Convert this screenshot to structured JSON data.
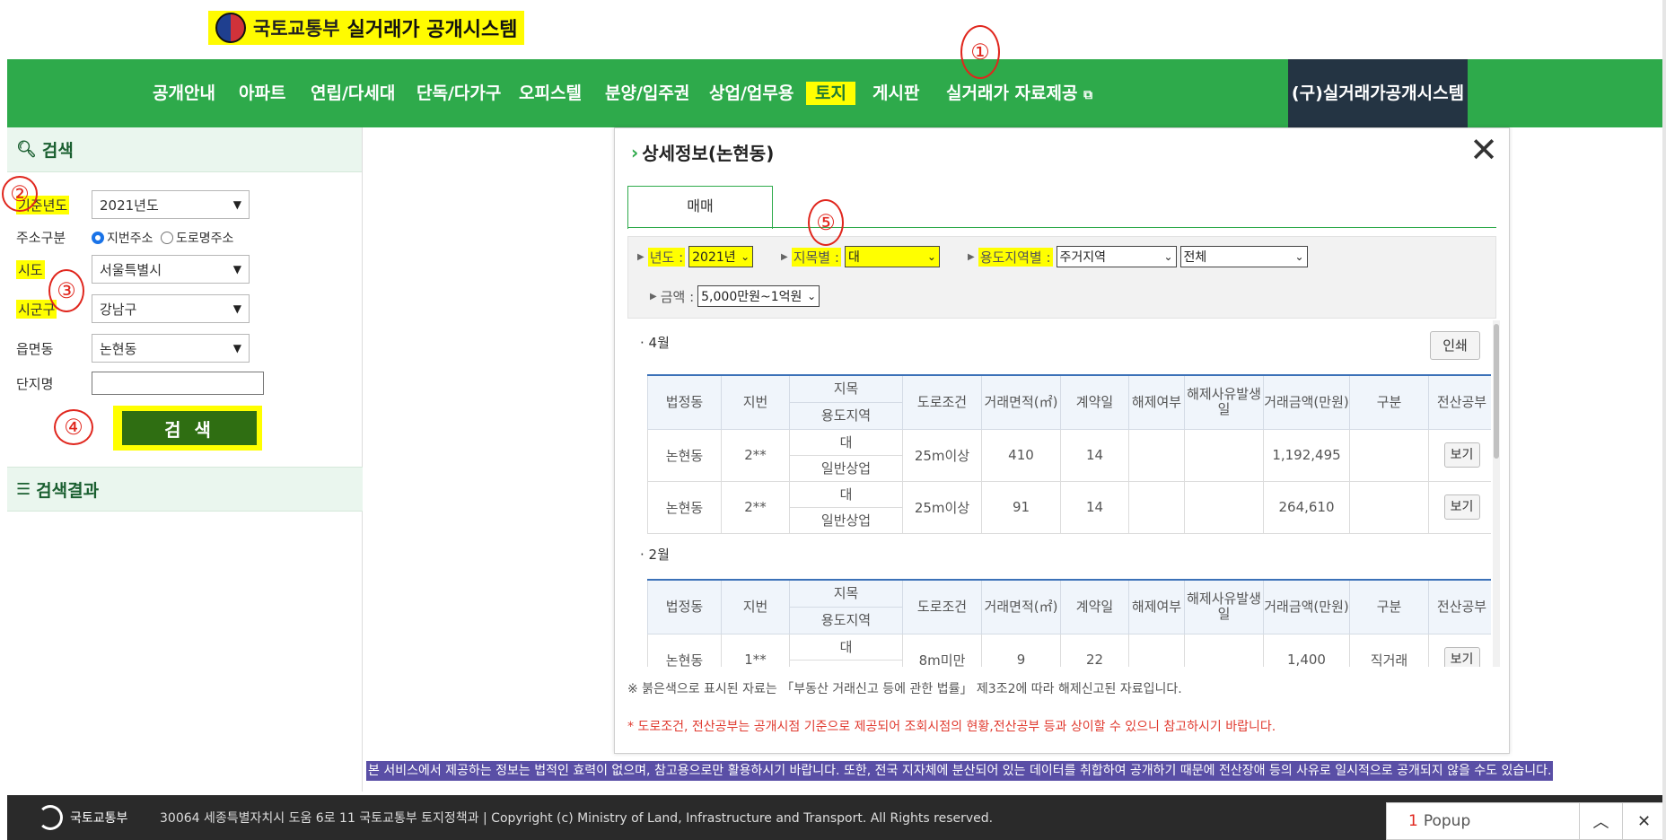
{
  "header": {
    "ministry": "국토교통부",
    "system_title": "실거래가 공개시스템"
  },
  "nav": {
    "items": [
      "공개안내",
      "아파트",
      "연립/다세대",
      "단독/다가구",
      "오피스텔",
      "분양/입주권",
      "상업/업무용",
      "토지",
      "게시판",
      "실거래가 자료제공"
    ],
    "old_system": "(구)실거래가공개시스템",
    "active": "토지"
  },
  "sidebar": {
    "search_title": "검색",
    "year_label": "기준년도",
    "year_value": "2021년도",
    "addr_type_label": "주소구분",
    "addr_jibun": "지번주소",
    "addr_road": "도로명주소",
    "sido_label": "시도",
    "sido_value": "서울특별시",
    "sigungu_label": "시군구",
    "sigungu_value": "강남구",
    "eupmyeondong_label": "읍면동",
    "eupmyeondong_value": "논현동",
    "complex_label": "단지명",
    "complex_value": "",
    "search_button": "검 색",
    "results_title": "검색결과"
  },
  "annotations": [
    "①",
    "②",
    "③",
    "④",
    "⑤"
  ],
  "modal": {
    "title": "상세정보(논현동)",
    "close": "✕",
    "tab": "매매",
    "filters": {
      "year_label": "년도 :",
      "year_value": "2021년",
      "jimok_label": "지목별 :",
      "jimok_value": "대",
      "zone_label": "용도지역별 :",
      "zone_value": "주거지역",
      "zone_sub_value": "전체",
      "amount_label": "금액 :",
      "amount_value": "5,000만원~1억원"
    },
    "print_button": "인쇄",
    "columns": {
      "beopjeongdong": "법정동",
      "jibun": "지번",
      "jimok": "지목",
      "yongdo": "용도지역",
      "road": "도로조건",
      "area": "거래면적(㎡)",
      "contract_day": "계약일",
      "cancel": "해제여부",
      "cancel_date": "해제사유발생일",
      "amount": "거래금액(만원)",
      "type": "구분",
      "registry": "전산공부"
    },
    "sections": [
      {
        "month": "4월",
        "rows": [
          {
            "dong": "논현동",
            "jibun": "2**",
            "jimok": "대",
            "yongdo": "일반상업",
            "road": "25m이상",
            "area": "410",
            "day": "14",
            "cancel": "",
            "cancel_date": "",
            "amount": "1,192,495",
            "type": "",
            "view": "보기"
          },
          {
            "dong": "논현동",
            "jibun": "2**",
            "jimok": "대",
            "yongdo": "일반상업",
            "road": "25m이상",
            "area": "91",
            "day": "14",
            "cancel": "",
            "cancel_date": "",
            "amount": "264,610",
            "type": "",
            "view": "보기"
          }
        ]
      },
      {
        "month": "2월",
        "rows": [
          {
            "dong": "논현동",
            "jibun": "1**",
            "jimok": "대",
            "yongdo": "",
            "road": "8m미만",
            "area": "9",
            "day": "22",
            "cancel": "",
            "cancel_date": "",
            "amount": "1,400",
            "type": "직거래",
            "view": "보기"
          }
        ]
      }
    ],
    "notice": "※ 붉은색으로 표시된 자료는 「부동산 거래신고 등에 관한 법률」 제3조2에 따라 해제신고된 자료입니다.",
    "notice_red": "* 도로조건, 전산공부는 공개시점 기준으로 제공되어 조회시점의 현황,전산공부 등과 상이할 수 있으니 참고하시기 바랍니다."
  },
  "disclaimer": "본 서비스에서 제공하는 정보는 법적인 효력이 없으며, 참고용으로만 활용하시기 바랍니다. 또한, 전국 지자체에 분산되어 있는 데이터를 취합하여 공개하기 때문에 전산장애 등의 사유로 일시적으로 공개되지 않을 수도 있습니다.",
  "footer": {
    "logo_text": "국토교통부",
    "address": "30064 세종특별자치시 도움 6로 11 국토교통부 토지정책과  |  Copyright (c) Ministry of Land, Infrastructure and Transport. All Rights reserved."
  },
  "popup": {
    "count": "1",
    "label": "Popup"
  },
  "colors": {
    "nav_green": "#2eaa4b",
    "nav_dark": "#243443",
    "highlight": "#ffff00",
    "search_button": "#2f6e12",
    "table_accent": "#3b71b8",
    "disclaimer_bg": "#5a4fa6"
  }
}
